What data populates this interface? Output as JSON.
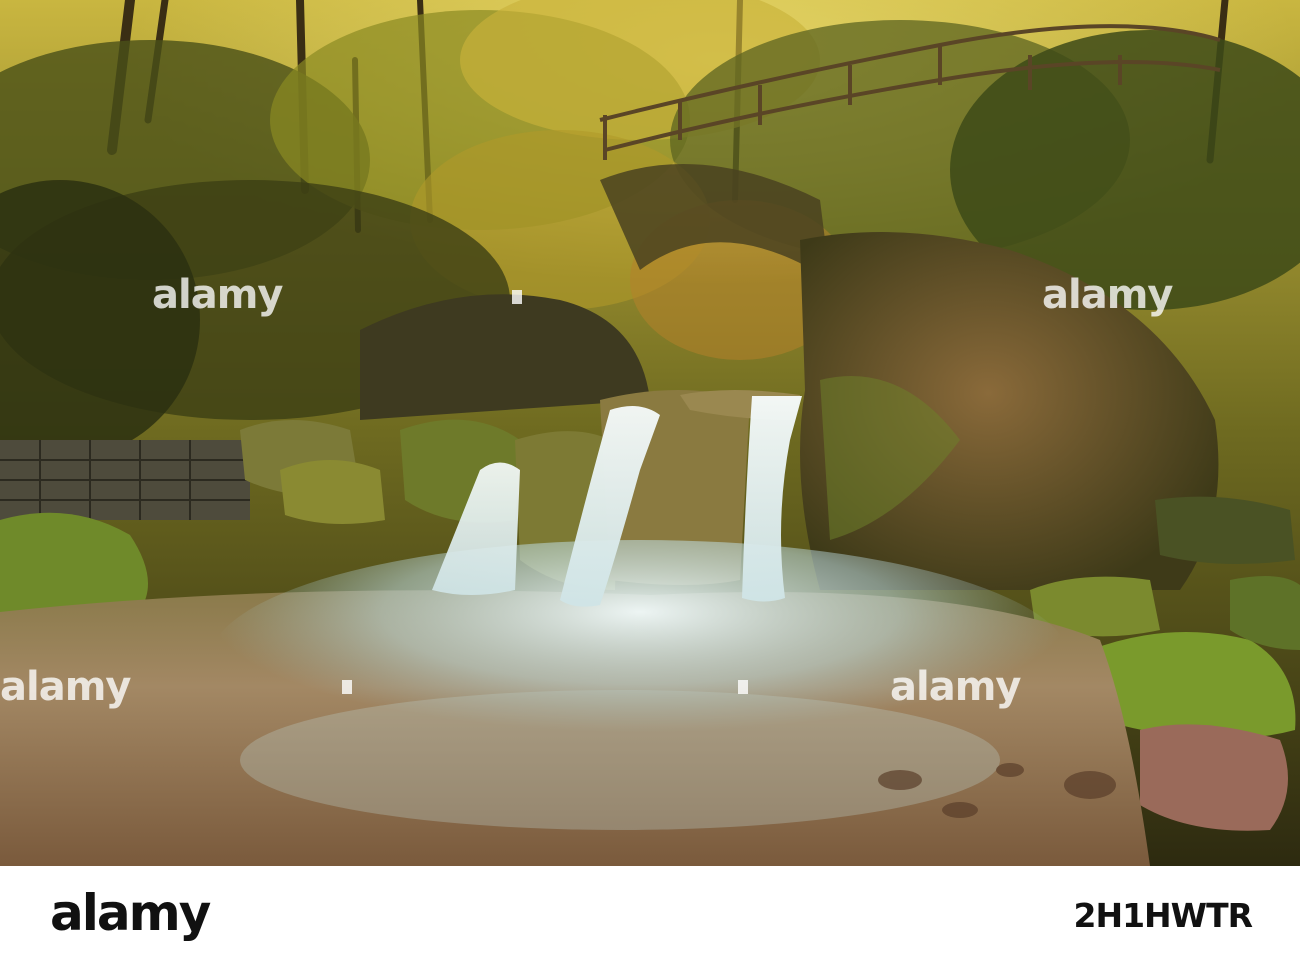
{
  "watermark": {
    "text": "alamy",
    "color": "#ffffff"
  },
  "footer": {
    "logo_text": "alamy",
    "image_code": "2H1HWTR"
  },
  "palette": {
    "foliage_gold": "#b59a2e",
    "foliage_dark": "#2f3414",
    "rock_moss": "#6e7f2a",
    "water_white": "#e9f3f4",
    "pool_amber": "#a4835a"
  }
}
